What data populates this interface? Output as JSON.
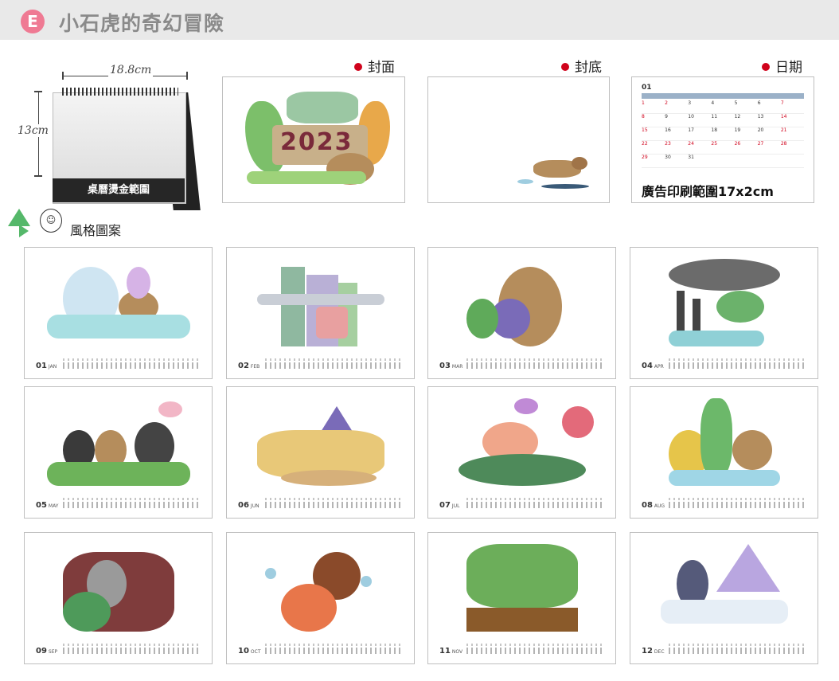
{
  "header": {
    "badge": "E",
    "title": "小石虎的奇幻冒險"
  },
  "diagram": {
    "width_label": "18.8cm",
    "height_label": "13cm",
    "stand_label": "桌曆燙金範圍"
  },
  "style_label": "風格圖案",
  "sections": {
    "cover": "封面",
    "back": "封底",
    "date": "日期"
  },
  "cover": {
    "year": "2023"
  },
  "date_page": {
    "month": "01",
    "ad_range": "廣告印刷範圍17x2cm"
  },
  "months": [
    {
      "num": "01",
      "abbr": "JAN"
    },
    {
      "num": "02",
      "abbr": "FEB"
    },
    {
      "num": "03",
      "abbr": "MAR"
    },
    {
      "num": "04",
      "abbr": "APR"
    },
    {
      "num": "05",
      "abbr": "MAY"
    },
    {
      "num": "06",
      "abbr": "JUN"
    },
    {
      "num": "07",
      "abbr": "JUL"
    },
    {
      "num": "08",
      "abbr": "AUG"
    },
    {
      "num": "09",
      "abbr": "SEP"
    },
    {
      "num": "10",
      "abbr": "OCT"
    },
    {
      "num": "11",
      "abbr": "NOV"
    },
    {
      "num": "12",
      "abbr": "DEC"
    }
  ],
  "colors": {
    "badge": "#ef7a93",
    "accent_red": "#d0021b",
    "header_bg": "#e9e9e9",
    "style_green": "#55b86a"
  }
}
